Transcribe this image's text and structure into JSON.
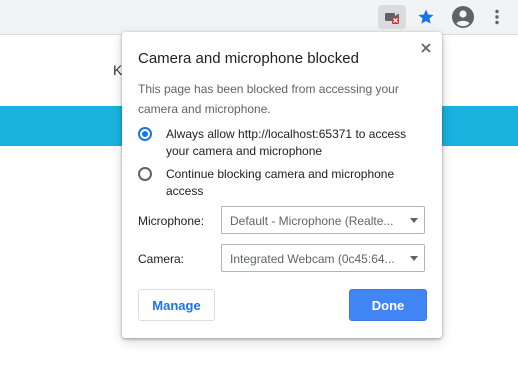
{
  "toolbar": {
    "icons": [
      "camera-blocked-icon",
      "star-icon",
      "account-icon",
      "more-vert-icon"
    ],
    "accent_color": "#1a73e8"
  },
  "page": {
    "visible_text": "K",
    "band_color": "#1ab3e0"
  },
  "popup": {
    "title": "Camera and microphone blocked",
    "message": "This page has been blocked from accessing your camera and microphone.",
    "options": [
      {
        "label": "Always allow http://localhost:65371 to access your camera and microphone",
        "selected": true
      },
      {
        "label": "Continue blocking camera and microphone access",
        "selected": false
      }
    ],
    "microphone": {
      "label": "Microphone:",
      "value": "Default - Microphone (Realte..."
    },
    "camera": {
      "label": "Camera:",
      "value": "Integrated Webcam (0c45:64..."
    },
    "manage_label": "Manage",
    "done_label": "Done",
    "done_color": "#4285f4"
  }
}
